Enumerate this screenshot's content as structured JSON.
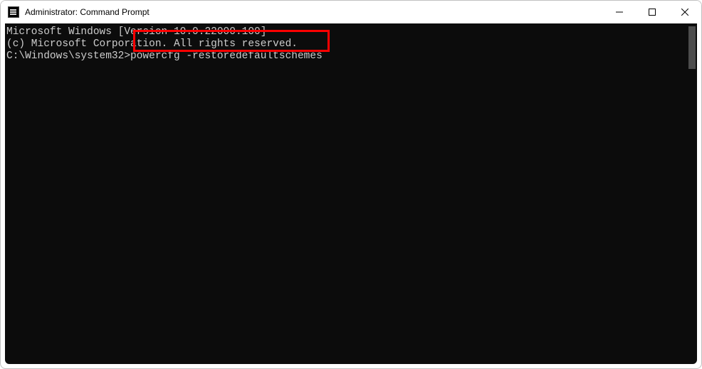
{
  "window": {
    "title": "Administrator: Command Prompt"
  },
  "terminal": {
    "line1": "Microsoft Windows [Version 10.0.22000.100]",
    "line2": "(c) Microsoft Corporation. All rights reserved.",
    "blank": "",
    "prompt": "C:\\Windows\\system32>",
    "command": "powercfg -restoredefaultschemes"
  },
  "controls": {
    "minimize": "minimize",
    "maximize": "maximize",
    "close": "close"
  }
}
